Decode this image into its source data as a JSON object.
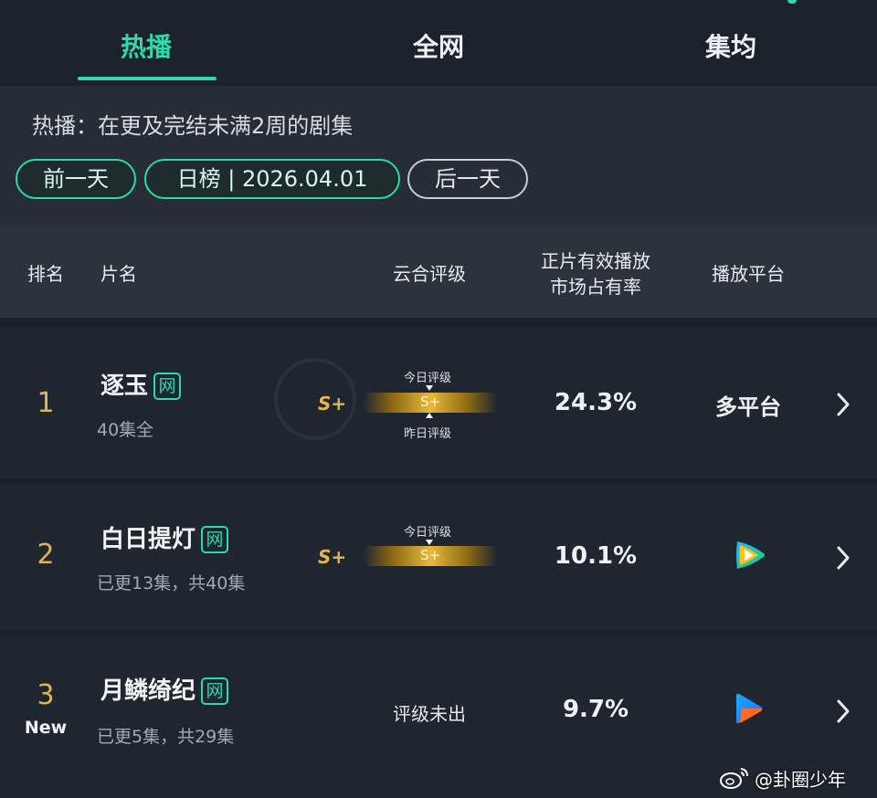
{
  "tabs": [
    {
      "label": "热播",
      "active": true
    },
    {
      "label": "全网",
      "active": false
    },
    {
      "label": "集均",
      "active": false
    }
  ],
  "info": {
    "subtitle": "热播：在更及完结未满2周的剧集",
    "prev_day": "前一天",
    "date_label": "日榜 | 2026.04.01",
    "next_day": "后一天"
  },
  "table_header": {
    "rank": "排名",
    "title": "片名",
    "grade": "云合评级",
    "share_line1": "正片有效播放",
    "share_line2": "市场占有率",
    "platform": "播放平台"
  },
  "rows": [
    {
      "rank": "1",
      "title": "逐玉",
      "tag": "网",
      "episodes": "40集全",
      "grade": "S+",
      "today_label": "今日评级",
      "bar_grade": "S+",
      "yesterday_label": "昨日评级",
      "share": "24.3%",
      "platform": "多平台"
    },
    {
      "rank": "2",
      "title": "白日提灯",
      "tag": "网",
      "episodes": "已更13集，共40集",
      "grade": "S+",
      "today_label": "今日评级",
      "bar_grade": "S+",
      "share": "10.1%",
      "platform_icon": "tencent-video-icon"
    },
    {
      "rank": "3",
      "badge": "New",
      "title": "月鳞绮纪",
      "tag": "网",
      "episodes": "已更5集，共29集",
      "grade_text": "评级未出",
      "share": "9.7%",
      "platform_icon": "youku-icon"
    }
  ],
  "watermark": "@卦圈少年",
  "colors": {
    "accent": "#2fd9a8",
    "gold": "#e3b553",
    "background": "#1b212b"
  }
}
